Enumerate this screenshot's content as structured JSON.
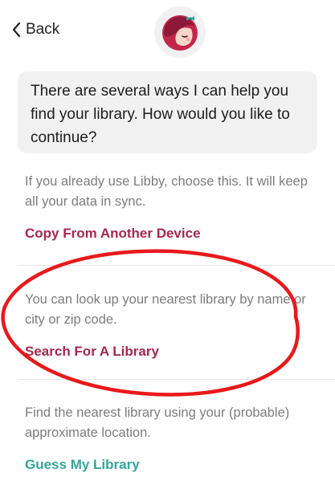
{
  "header": {
    "back_label": "Back",
    "logo_icon": "libby-logo-icon"
  },
  "message": {
    "text": "There are several ways I can help you find your library. How would you like to continue?"
  },
  "options": [
    {
      "description": "If you already use Libby, choose this. It will keep all your data in sync.",
      "action_label": "Copy From Another Device",
      "action_color": "#a8274e"
    },
    {
      "description": "You can look up your nearest library by name or city or zip code.",
      "action_label": "Search For A Library",
      "action_color": "#a8274e"
    },
    {
      "description": "Find the nearest library using your (probable) approximate location.",
      "action_label": "Guess My Library",
      "action_color": "#35a49a"
    }
  ],
  "annotation": {
    "shape": "ellipse",
    "color": "#e8191b",
    "highlights": "Search For A Library"
  }
}
